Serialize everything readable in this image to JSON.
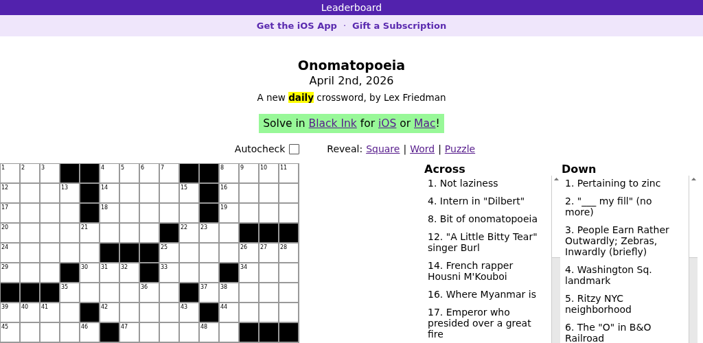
{
  "top_bar": {
    "label": "Leaderboard"
  },
  "promo_links": [
    {
      "label": "Get the iOS App"
    },
    {
      "label": "Gift a Subscription"
    }
  ],
  "promo_separator": "·",
  "puzzle": {
    "title": "Onomatopoeia",
    "date": "April 2nd, 2026",
    "tagline": {
      "before": "A new ",
      "highlight": "daily",
      "after": " crossword, by Lex Friedman"
    }
  },
  "solve_banner": [
    {
      "text": "Solve in ",
      "link": false
    },
    {
      "text": "Black Ink",
      "link": true
    },
    {
      "text": " for ",
      "link": false
    },
    {
      "text": "iOS",
      "link": true
    },
    {
      "text": " or ",
      "link": false
    },
    {
      "text": "Mac",
      "link": true
    },
    {
      "text": "!",
      "link": false
    }
  ],
  "autocheck": {
    "label": "Autocheck",
    "checked": false
  },
  "reveal": {
    "label": "Reveal:",
    "options": [
      "Square",
      "Word",
      "Puzzle"
    ],
    "separator": "|"
  },
  "grid": {
    "rows": [
      [
        {
          "black": false,
          "number": "1"
        },
        {
          "black": false,
          "number": "2"
        },
        {
          "black": false,
          "number": "3"
        },
        {
          "black": true
        },
        {
          "black": true
        },
        {
          "black": false,
          "number": "4"
        },
        {
          "black": false,
          "number": "5"
        },
        {
          "black": false,
          "number": "6"
        },
        {
          "black": false,
          "number": "7"
        },
        {
          "black": true
        },
        {
          "black": true
        },
        {
          "black": false,
          "number": "8"
        },
        {
          "black": false,
          "number": "9"
        },
        {
          "black": false,
          "number": "10"
        },
        {
          "black": false,
          "number": "11"
        }
      ],
      [
        {
          "black": false,
          "number": "12"
        },
        {
          "black": false
        },
        {
          "black": false
        },
        {
          "black": false,
          "number": "13"
        },
        {
          "black": true
        },
        {
          "black": false,
          "number": "14"
        },
        {
          "black": false
        },
        {
          "black": false
        },
        {
          "black": false
        },
        {
          "black": false,
          "number": "15"
        },
        {
          "black": true
        },
        {
          "black": false,
          "number": "16"
        },
        {
          "black": false
        },
        {
          "black": false
        },
        {
          "black": false
        }
      ],
      [
        {
          "black": false,
          "number": "17"
        },
        {
          "black": false
        },
        {
          "black": false
        },
        {
          "black": false
        },
        {
          "black": true
        },
        {
          "black": false,
          "number": "18"
        },
        {
          "black": false
        },
        {
          "black": false
        },
        {
          "black": false
        },
        {
          "black": false
        },
        {
          "black": true
        },
        {
          "black": false,
          "number": "19"
        },
        {
          "black": false
        },
        {
          "black": false
        },
        {
          "black": false
        }
      ],
      [
        {
          "black": false,
          "number": "20"
        },
        {
          "black": false
        },
        {
          "black": false
        },
        {
          "black": false
        },
        {
          "black": false,
          "number": "21"
        },
        {
          "black": false
        },
        {
          "black": false
        },
        {
          "black": false
        },
        {
          "black": true
        },
        {
          "black": false,
          "number": "22"
        },
        {
          "black": false,
          "number": "23"
        },
        {
          "black": false
        },
        {
          "black": true
        },
        {
          "black": true
        },
        {
          "black": true
        }
      ],
      [
        {
          "black": false,
          "number": "24"
        },
        {
          "black": false
        },
        {
          "black": false
        },
        {
          "black": false
        },
        {
          "black": false
        },
        {
          "black": true
        },
        {
          "black": true
        },
        {
          "black": true
        },
        {
          "black": false,
          "number": "25"
        },
        {
          "black": false
        },
        {
          "black": false
        },
        {
          "black": false
        },
        {
          "black": false,
          "number": "26"
        },
        {
          "black": false,
          "number": "27"
        },
        {
          "black": false,
          "number": "28"
        }
      ],
      [
        {
          "black": false,
          "number": "29"
        },
        {
          "black": false
        },
        {
          "black": false
        },
        {
          "black": true
        },
        {
          "black": false,
          "number": "30"
        },
        {
          "black": false,
          "number": "31"
        },
        {
          "black": false,
          "number": "32"
        },
        {
          "black": true
        },
        {
          "black": false,
          "number": "33"
        },
        {
          "black": false
        },
        {
          "black": false
        },
        {
          "black": true
        },
        {
          "black": false,
          "number": "34"
        },
        {
          "black": false
        },
        {
          "black": false
        }
      ],
      [
        {
          "black": true
        },
        {
          "black": true
        },
        {
          "black": true
        },
        {
          "black": false,
          "number": "35"
        },
        {
          "black": false
        },
        {
          "black": false
        },
        {
          "black": false
        },
        {
          "black": false,
          "number": "36"
        },
        {
          "black": false
        },
        {
          "black": true
        },
        {
          "black": false,
          "number": "37"
        },
        {
          "black": false,
          "number": "38"
        },
        {
          "black": false
        },
        {
          "black": false
        },
        {
          "black": false
        }
      ],
      [
        {
          "black": false,
          "number": "39"
        },
        {
          "black": false,
          "number": "40"
        },
        {
          "black": false,
          "number": "41"
        },
        {
          "black": false
        },
        {
          "black": true
        },
        {
          "black": false,
          "number": "42"
        },
        {
          "black": false
        },
        {
          "black": false
        },
        {
          "black": false
        },
        {
          "black": false,
          "number": "43"
        },
        {
          "black": true
        },
        {
          "black": false,
          "number": "44"
        },
        {
          "black": false
        },
        {
          "black": false
        },
        {
          "black": false
        }
      ],
      [
        {
          "black": false,
          "number": "45"
        },
        {
          "black": false
        },
        {
          "black": false
        },
        {
          "black": false
        },
        {
          "black": false,
          "number": "46"
        },
        {
          "black": true
        },
        {
          "black": false,
          "number": "47"
        },
        {
          "black": false
        },
        {
          "black": false
        },
        {
          "black": false
        },
        {
          "black": false,
          "number": "48"
        },
        {
          "black": false
        },
        {
          "black": true
        },
        {
          "black": true
        },
        {
          "black": true
        }
      ]
    ]
  },
  "clue_lists": [
    {
      "heading": "Across",
      "clues": [
        "1. Not laziness",
        "4. Intern in \"Dilbert\"",
        "8. Bit of onomatopoeia",
        "12. \"A Little Bitty Tear\" singer Burl",
        "14. French rapper Housni M'Kouboi",
        "16. Where Myanmar is",
        "17. Emperor who presided over a great fire"
      ]
    },
    {
      "heading": "Down",
      "clues": [
        "1. Pertaining to zinc",
        "2. \"___ my fill\" (no more)",
        "3. People Earn Rather Outwardly; Zebras, Inwardly (briefly)",
        "4. Washington Sq. landmark",
        "5. Ritzy NYC neighborhood",
        "6. The \"O\" in B&O Railroad"
      ]
    }
  ]
}
